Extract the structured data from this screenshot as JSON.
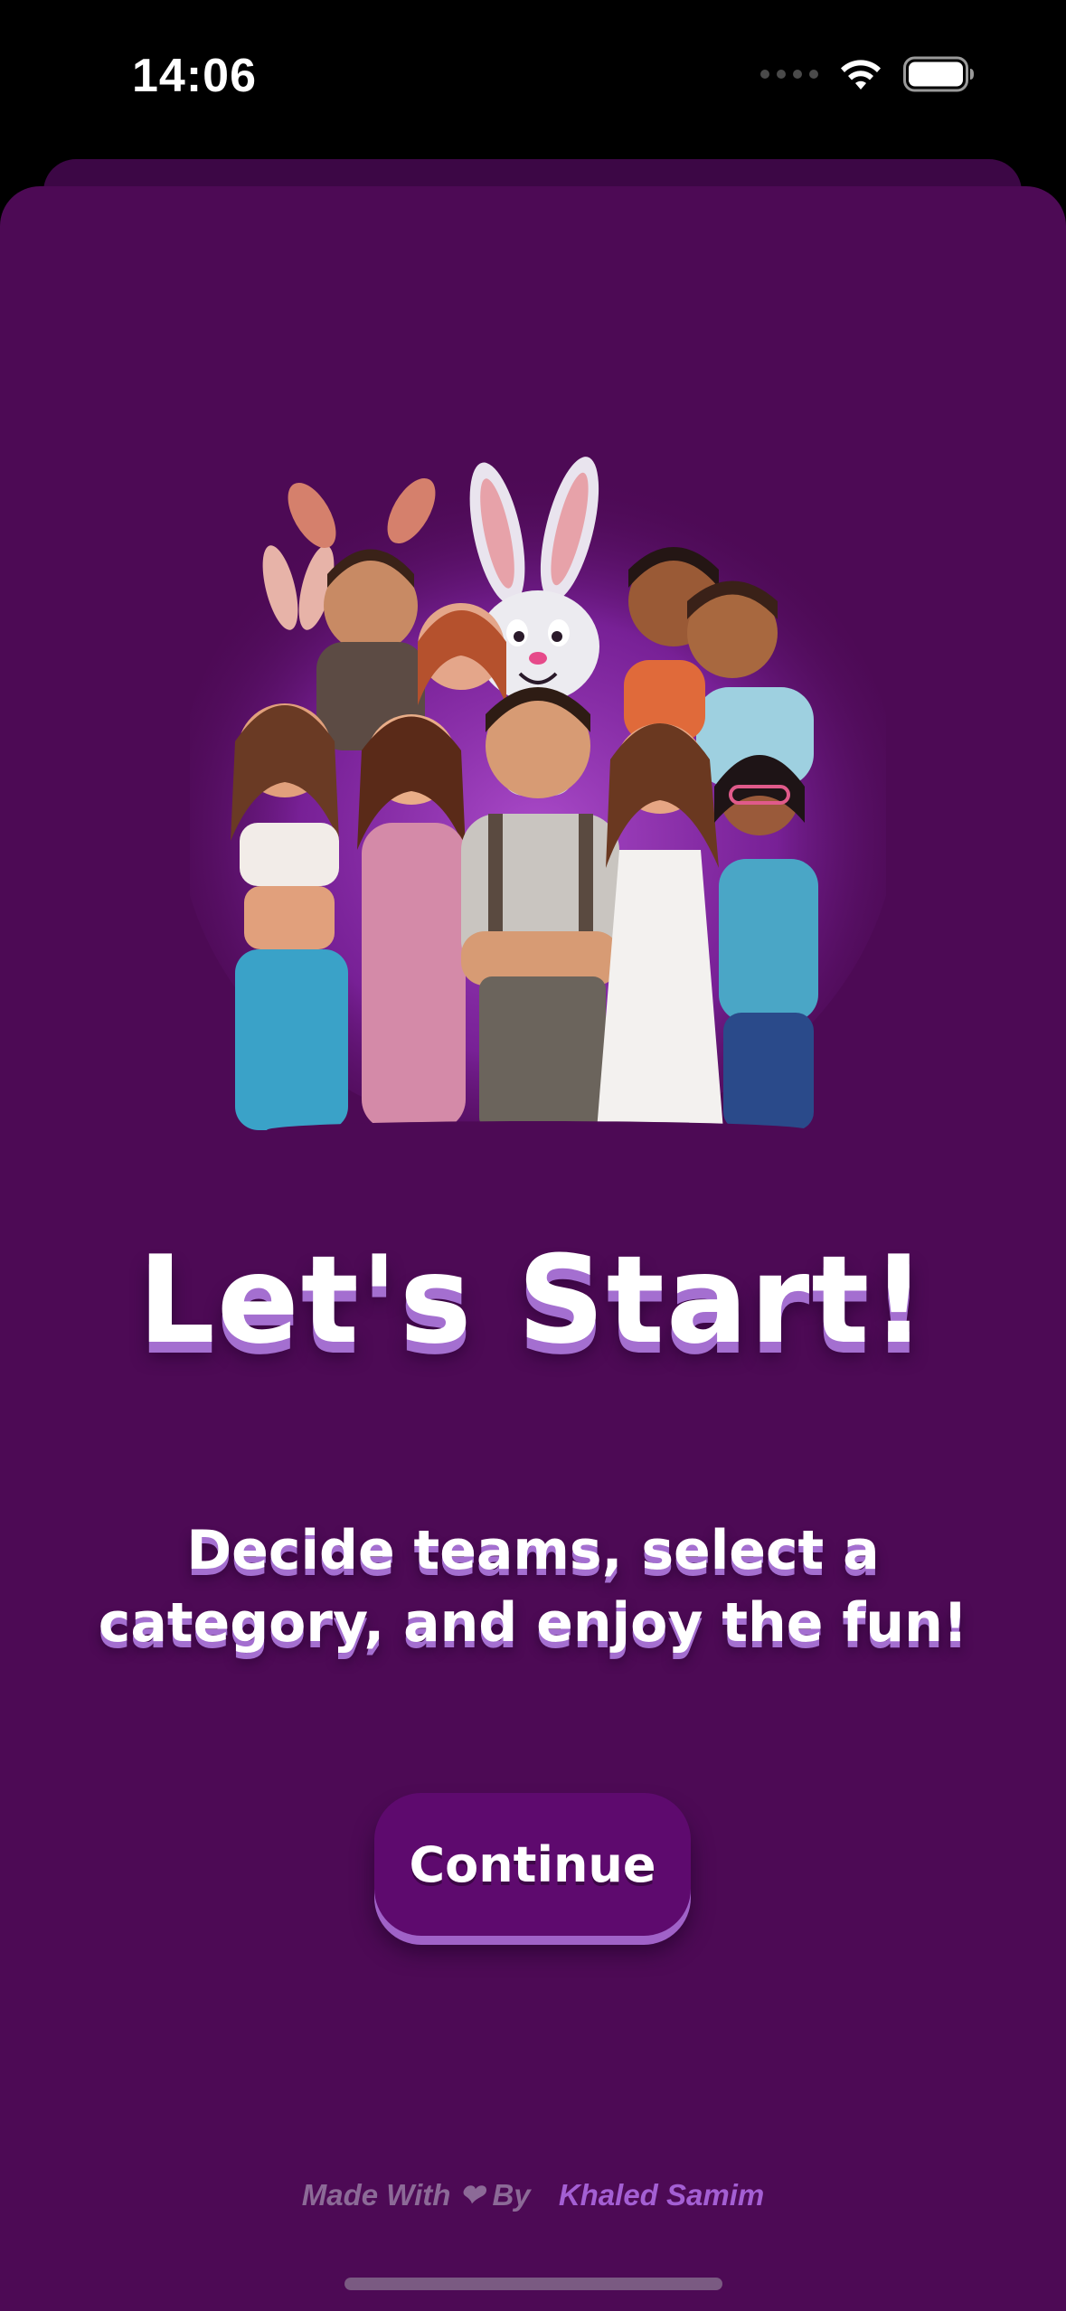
{
  "status_bar": {
    "time": "14:06"
  },
  "hero": {
    "image_alt": "group of cartoon friends with bunny"
  },
  "title": "Let's Start!",
  "subtitle": "Decide teams, select a category, and enjoy the fun!",
  "continue_label": "Continue",
  "footer": {
    "made_with": "Made With",
    "heart": "❤",
    "by": "By",
    "author": "Khaled Samim"
  },
  "colors": {
    "background": "#4d0a55",
    "button": "#5e0a6e",
    "accent": "#a45fd4",
    "text_shadow": "#a46fd0"
  }
}
